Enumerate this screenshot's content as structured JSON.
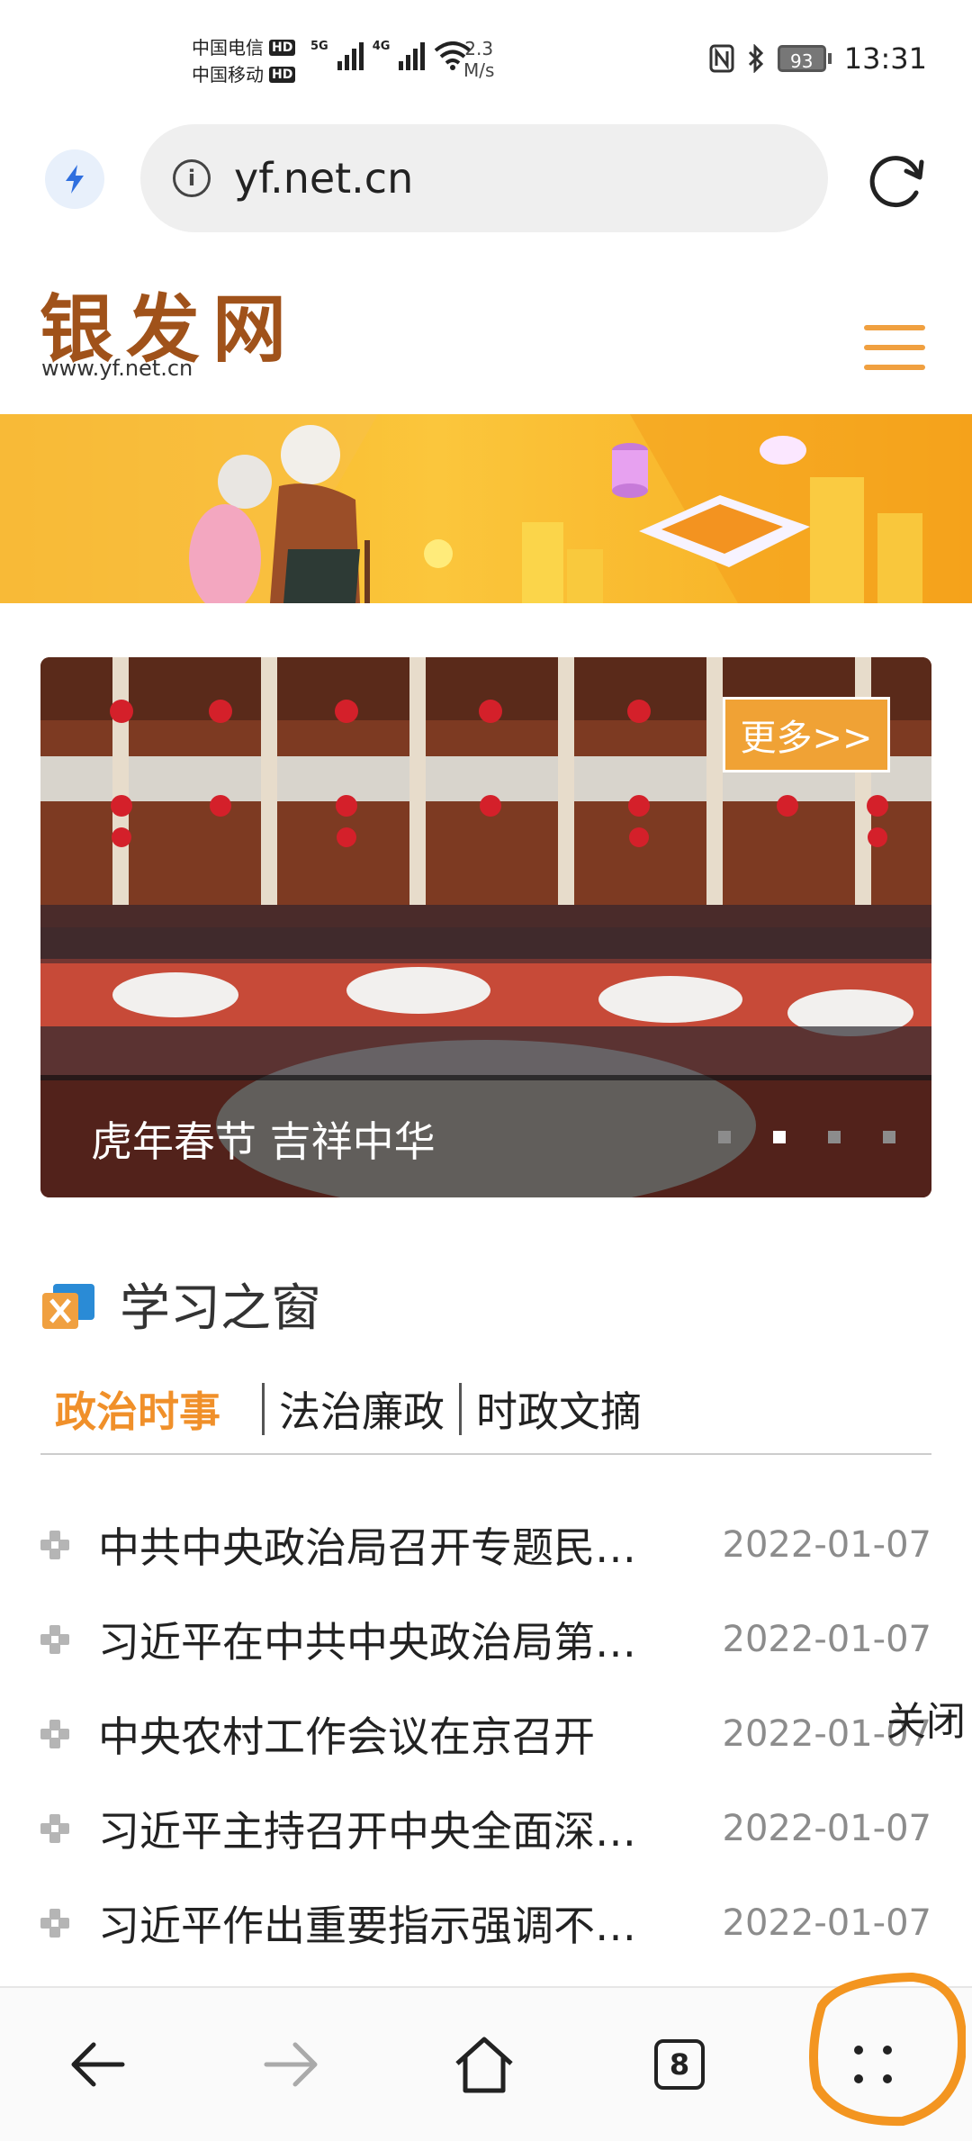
{
  "status_bar": {
    "carrier_1": "中国电信",
    "carrier_2": "中国移动",
    "hd_badge": "HD",
    "net_5g": "5G",
    "net_4g": "4G",
    "speed_value": "2.3",
    "speed_unit": "M/s",
    "battery": "93",
    "time": "13:31"
  },
  "browser": {
    "url": "yf.net.cn",
    "info_glyph": "i"
  },
  "site": {
    "logo_text": "银发网",
    "url": "www.yf.net.cn"
  },
  "slider": {
    "more_label": "更多>>",
    "caption": "虎年春节 吉祥中华",
    "active_index": 1,
    "dot_count": 4
  },
  "section": {
    "title": "学习之窗",
    "tabs": [
      "政治时事",
      "法治廉政",
      "时政文摘"
    ],
    "active_tab": 0
  },
  "news": [
    {
      "title": "中共中央政治局召开专题民…",
      "date": "2022-01-07"
    },
    {
      "title": "习近平在中共中央政治局第…",
      "date": "2022-01-07"
    },
    {
      "title": "中央农村工作会议在京召开",
      "date": "2022-01-07"
    },
    {
      "title": "习近平主持召开中央全面深…",
      "date": "2022-01-07"
    },
    {
      "title": "习近平作出重要指示强调不…",
      "date": "2022-01-07"
    }
  ],
  "close_label": "关闭",
  "bottom_nav": {
    "tab_count": "8"
  },
  "colors": {
    "accent_orange": "#f0902a",
    "logo_brown": "#a0521a",
    "banner_yellow": "#fbc63c",
    "lantern_red": "#d4202a"
  },
  "icons": [
    "flash-icon",
    "info-icon",
    "refresh-icon",
    "menu-icon",
    "back-icon",
    "forward-icon",
    "home-icon",
    "tabs-icon",
    "more-icon"
  ]
}
